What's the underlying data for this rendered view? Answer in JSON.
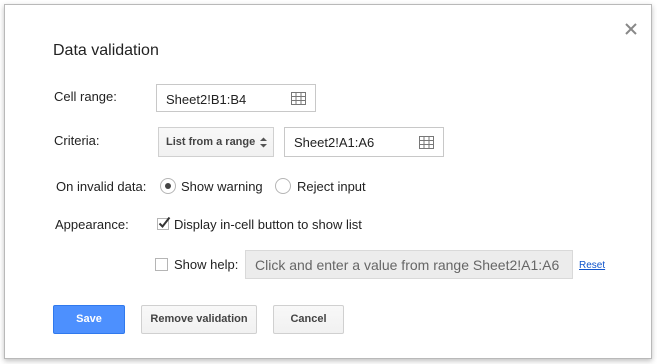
{
  "dialog": {
    "title": "Data validation",
    "close_icon": "close-icon"
  },
  "cell_range": {
    "label": "Cell range:",
    "value": "Sheet2!B1:B4",
    "icon": "grid-icon"
  },
  "criteria": {
    "label": "Criteria:",
    "type_selected": "List from a range",
    "range_value": "Sheet2!A1:A6",
    "icon": "grid-icon"
  },
  "invalid_data": {
    "label": "On invalid data:",
    "options": [
      {
        "label": "Show warning",
        "selected": true
      },
      {
        "label": "Reject input",
        "selected": false
      }
    ]
  },
  "appearance": {
    "label": "Appearance:",
    "show_list_button": {
      "label": "Display in-cell button to show list",
      "checked": true
    },
    "show_help": {
      "label": "Show help:",
      "checked": false
    },
    "help_text": "Click and enter a value from range Sheet2!A1:A6",
    "reset_label": "Reset"
  },
  "buttons": {
    "save": "Save",
    "remove": "Remove validation",
    "cancel": "Cancel"
  },
  "colors": {
    "primary": "#4d90fe",
    "link": "#1155cc"
  }
}
